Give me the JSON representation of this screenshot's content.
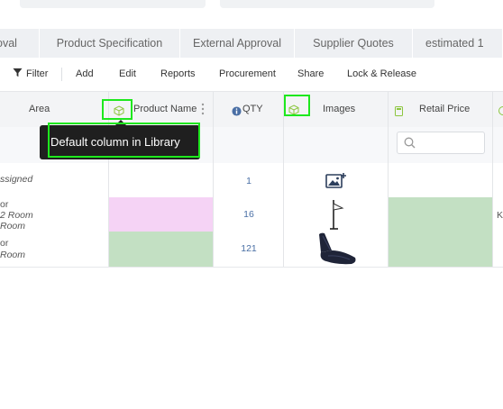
{
  "tabs": [
    "oval",
    "Product Specification",
    "External Approval",
    "Supplier Quotes",
    "estimated 1"
  ],
  "toolbar": {
    "filter": "Filter",
    "add": "Add",
    "edit": "Edit",
    "reports": "Reports",
    "procurement": "Procurement",
    "share": "Share",
    "lock_release": "Lock & Release"
  },
  "columns": {
    "area": "Area",
    "product_name": "Product Name",
    "qty": "QTY",
    "images": "Images",
    "retail_price": "Retail Price"
  },
  "tooltip": "Default column in Library",
  "rows": [
    {
      "area_lines": [
        "ssigned"
      ],
      "qty": "1",
      "name_fill": "",
      "price_fill": "",
      "extra": ""
    },
    {
      "area_lines": [
        "or",
        "2 Room",
        "Room"
      ],
      "qty": "16",
      "extra": "K"
    },
    {
      "area_lines": [
        "or",
        "Room"
      ],
      "qty": "121",
      "extra": ""
    }
  ],
  "colors": {
    "pink_fill": "#f5d3f5",
    "green_fill": "#c3e0c3",
    "highlight": "#1ee81e",
    "qty_blue": "#4a6fa5",
    "library_icon": "#8cc63f"
  },
  "icons": {
    "library": "cube-icon",
    "info": "info-icon",
    "filter": "funnel-icon",
    "kebab": "kebab-icon",
    "search": "search-icon",
    "image_placeholder": "image-add-icon"
  }
}
